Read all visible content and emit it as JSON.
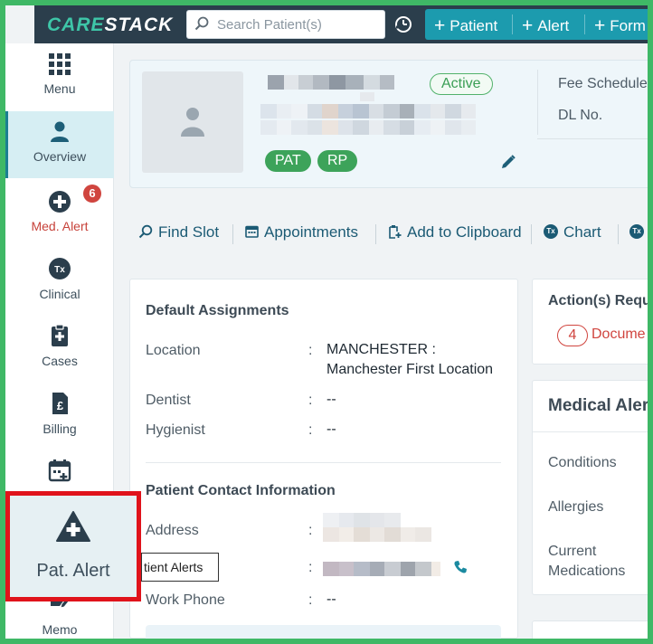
{
  "app": {
    "logo_part1": "CARE",
    "logo_part2": "STACK"
  },
  "search": {
    "placeholder": "Search Patient(s)"
  },
  "quick_actions": [
    {
      "label": "Patient"
    },
    {
      "label": "Alert"
    },
    {
      "label": "Form"
    }
  ],
  "sidebar": {
    "items": [
      {
        "label": "Menu",
        "icon": "grid-icon"
      },
      {
        "label": "Overview",
        "icon": "person-icon",
        "active": true
      },
      {
        "label": "Med. Alert",
        "icon": "plus-circle-icon",
        "badge": "6"
      },
      {
        "label": "Clinical",
        "icon": "tx-icon"
      },
      {
        "label": "Cases",
        "icon": "clipboard-icon"
      },
      {
        "label": "Billing",
        "icon": "invoice-icon"
      },
      {
        "label": "",
        "icon": "calendar-plus-icon"
      },
      {
        "label": "Memo",
        "icon": "memo-icon"
      }
    ],
    "highlight": {
      "label": "Pat. Alert",
      "icon": "warning-plus-icon"
    }
  },
  "patient": {
    "status": "Active",
    "tags": [
      "PAT",
      "RP"
    ],
    "meta": {
      "fee_schedule_label": "Fee Schedule",
      "dl_label": "DL No."
    }
  },
  "action_bar": [
    {
      "label": "Find Slot",
      "icon": "search-icon"
    },
    {
      "label": "Appointments",
      "icon": "calendar-icon"
    },
    {
      "label": "Add to Clipboard",
      "icon": "clipboard-add-icon"
    },
    {
      "label": "Chart",
      "icon": "tx-icon"
    }
  ],
  "default_assignments": {
    "title": "Default Assignments",
    "rows": [
      {
        "label": "Location",
        "sep": ":",
        "value_line1": "MANCHESTER :",
        "value_line2": "Manchester First Location"
      },
      {
        "label": "Dentist",
        "sep": ":",
        "value": "--"
      },
      {
        "label": "Hygienist",
        "sep": ":",
        "value": "--"
      }
    ]
  },
  "contact": {
    "title": "Patient Contact Information",
    "address_label": "Address",
    "address_sep": ":",
    "tooltip": "tient Alerts",
    "phone_sep": ":",
    "work_phone_label": "Work Phone",
    "work_phone_sep": ":",
    "work_phone_value": "--"
  },
  "right": {
    "actions_title": "Action(s) Requ",
    "doc_count": "4",
    "doc_label": "Docume",
    "medical_title": "Medical Alert",
    "conditions": "Conditions",
    "allergies": "Allergies",
    "current_medications_1": "Current",
    "current_medications_2": "Medications"
  },
  "colors": {
    "frame": "#3fb866",
    "topbar": "#2b3e4c",
    "accent": "#1c9bae",
    "highlight_border": "#e0131b",
    "status_green": "#3da35a",
    "alert_red": "#d0453f"
  }
}
